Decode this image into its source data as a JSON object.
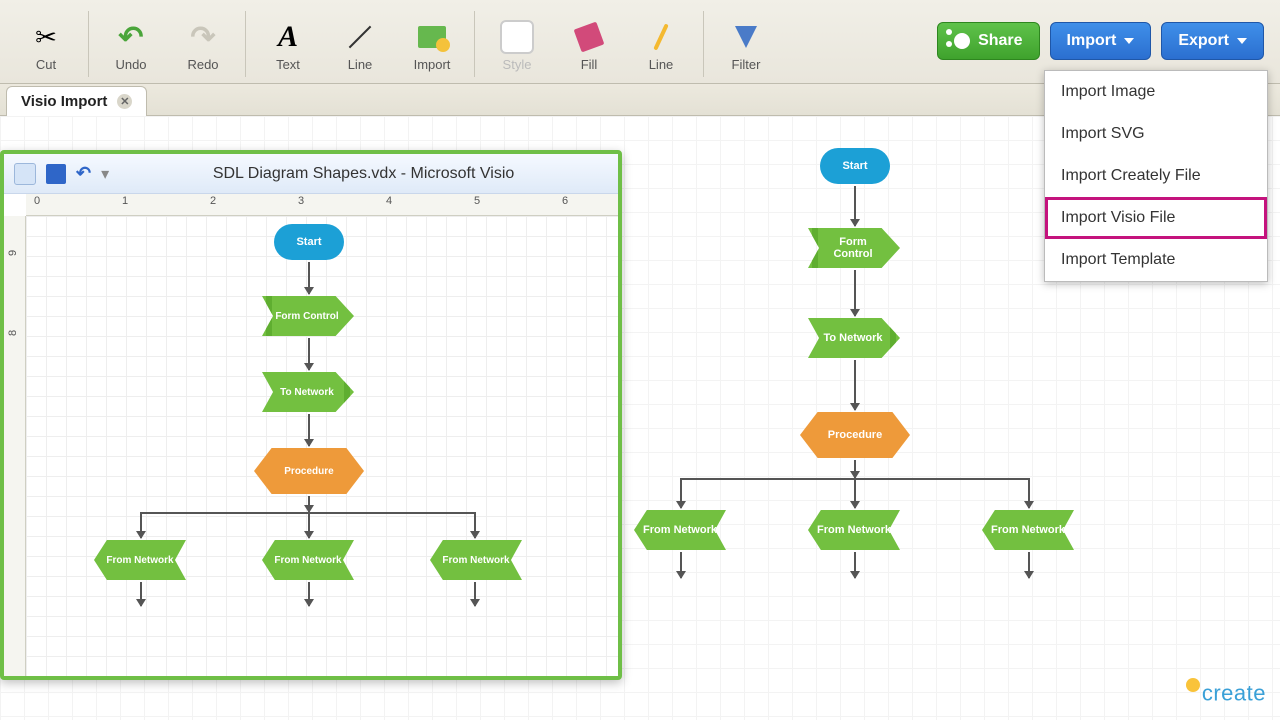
{
  "toolbar": {
    "cut": "Cut",
    "undo": "Undo",
    "redo": "Redo",
    "text": "Text",
    "line": "Line",
    "importTool": "Import",
    "style": "Style",
    "fill": "Fill",
    "line2": "Line",
    "filter": "Filter"
  },
  "buttons": {
    "share": "Share",
    "import": "Import",
    "export": "Export"
  },
  "tab": {
    "label": "Visio Import"
  },
  "dropdown": {
    "items": [
      "Import Image",
      "Import SVG",
      "Import Creately File",
      "Import Visio File",
      "Import Template"
    ],
    "highlighted": "Import Visio File"
  },
  "visio": {
    "title": "SDL Diagram Shapes.vdx  -  Microsoft Visio",
    "rulerH": [
      "0",
      "1",
      "2",
      "3",
      "4",
      "5",
      "6"
    ],
    "rulerV": [
      "8",
      "9"
    ]
  },
  "flow": {
    "start": "Start",
    "formControl": "Form Control",
    "toNetwork": "To Network",
    "procedure": "Procedure",
    "fromNetwork": "From Network"
  },
  "watermark": "create"
}
